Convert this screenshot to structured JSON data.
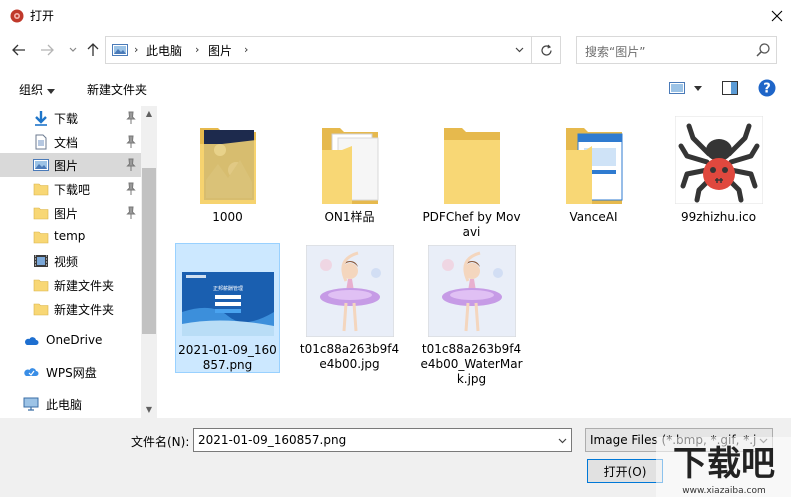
{
  "window": {
    "title": "打开"
  },
  "address": {
    "crumbs": [
      "此电脑",
      "图片"
    ]
  },
  "search": {
    "placeholder": "搜索“图片”"
  },
  "toolbar": {
    "organize": "组织",
    "new_folder": "新建文件夹"
  },
  "sidebar": {
    "items": [
      {
        "label": "下载",
        "icon": "download-icon",
        "pinned": true
      },
      {
        "label": "文档",
        "icon": "document-icon",
        "pinned": true
      },
      {
        "label": "图片",
        "icon": "pictures-icon",
        "pinned": true,
        "selected": true
      },
      {
        "label": "下载吧",
        "icon": "folder-icon",
        "pinned": true
      },
      {
        "label": "图片",
        "icon": "folder-icon",
        "pinned": true
      },
      {
        "label": "temp",
        "icon": "folder-icon",
        "pinned": false
      },
      {
        "label": "视频",
        "icon": "video-icon",
        "pinned": false
      },
      {
        "label": "新建文件夹",
        "icon": "folder-icon",
        "pinned": false
      },
      {
        "label": "新建文件夹",
        "icon": "folder-icon",
        "pinned": false
      },
      {
        "label": "OneDrive",
        "icon": "cloud-icon",
        "pinned": false
      },
      {
        "label": "WPS网盘",
        "icon": "wps-cloud-icon",
        "pinned": false
      },
      {
        "label": "此电脑",
        "icon": "computer-icon",
        "pinned": false
      }
    ]
  },
  "files": [
    {
      "name": "1000",
      "type": "folder-photo"
    },
    {
      "name": "ON1样品",
      "type": "folder-doc"
    },
    {
      "name": "PDFChef by Movavi",
      "type": "folder-empty"
    },
    {
      "name": "VanceAI",
      "type": "folder-app"
    },
    {
      "name": "99zhizhu.ico",
      "type": "spider-ico"
    },
    {
      "name": "2021-01-09_160857.png",
      "type": "screenshot",
      "selected": true
    },
    {
      "name": "t01c88a263b9f4e4b00.jpg",
      "type": "ballerina"
    },
    {
      "name": "t01c88a263b9f4e4b00_WaterMark.jpg",
      "type": "ballerina"
    }
  ],
  "footer": {
    "filename_label": "文件名(N):",
    "filename_value": "2021-01-09_160857.png",
    "filter_value": "Image Files (*.bmp, *.gif, *.jp",
    "open_button": "打开(O)"
  },
  "watermark": {
    "logo_text": "下载吧",
    "url_text": "www.xiazaiba.com"
  },
  "colors": {
    "accent": "#0078d7",
    "selection": "#cce8ff",
    "folder": "#f8d775",
    "help": "#1e65c8"
  }
}
